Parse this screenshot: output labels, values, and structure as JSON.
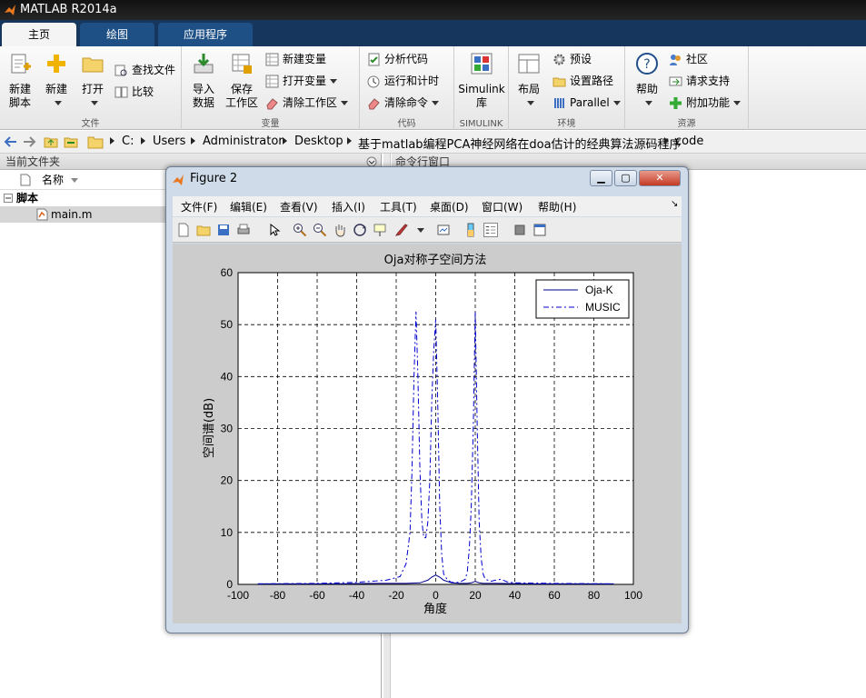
{
  "app": {
    "title": "MATLAB R2014a"
  },
  "tabs": [
    {
      "label": "主页"
    },
    {
      "label": "绘图"
    },
    {
      "label": "应用程序"
    }
  ],
  "ribbon": {
    "new_script": "新建\n脚本",
    "new": "新建",
    "open": "打开",
    "find_files": "查找文件",
    "compare": "比较",
    "file_caption": "文件",
    "import": "导入\n数据",
    "save_ws": "保存\n工作区",
    "new_var": "新建变量",
    "open_var": "打开变量",
    "clear_ws": "清除工作区",
    "var_caption": "变量",
    "analyze": "分析代码",
    "run_time": "运行和计时",
    "clear_cmd": "清除命令",
    "code_caption": "代码",
    "simulink": "Simulink\n库",
    "simulink_caption": "SIMULINK",
    "layout": "布局",
    "prefs": "预设",
    "set_path": "设置路径",
    "parallel": "Parallel",
    "env_caption": "环境",
    "help": "帮助",
    "community": "社区",
    "support": "请求支持",
    "addons": "附加功能",
    "res_caption": "资源"
  },
  "address": {
    "crumbs": [
      "C:",
      "Users",
      "Administrator",
      "Desktop",
      "基于matlab编程PCA神经网络在doa估计的经典算法源码程序",
      "code"
    ]
  },
  "left_panel": {
    "title": "当前文件夹",
    "col_name": "名称",
    "group": "脚本",
    "file": "main.m"
  },
  "command_window": {
    "title": "命令行窗口"
  },
  "figure": {
    "title": "Figure 2",
    "menu": [
      "文件(F)",
      "编辑(E)",
      "查看(V)",
      "插入(I)",
      "工具(T)",
      "桌面(D)",
      "窗口(W)",
      "帮助(H)"
    ]
  },
  "chart_data": {
    "type": "line",
    "title": "Oja对称子空间方法",
    "xlabel": "角度",
    "ylabel": "空间谱(dB)",
    "xlim": [
      -100,
      100
    ],
    "ylim": [
      0,
      60
    ],
    "xticks": [
      -100,
      -80,
      -60,
      -40,
      -20,
      0,
      20,
      40,
      60,
      80,
      100
    ],
    "yticks": [
      0,
      10,
      20,
      30,
      40,
      50,
      60
    ],
    "grid": true,
    "legend_position": "top-right",
    "series": [
      {
        "name": "Oja-K",
        "style": "solid",
        "color": "#00008b",
        "x": [
          -90,
          -70,
          -50,
          -30,
          -15,
          -8,
          -4,
          -2,
          0,
          2,
          4,
          8,
          12,
          16,
          18,
          20,
          22,
          24,
          30,
          50,
          70,
          90
        ],
        "y": [
          0.1,
          0.1,
          0.1,
          0.2,
          0.2,
          0.3,
          0.8,
          1.4,
          1.8,
          1.4,
          0.8,
          0.3,
          0.2,
          0.2,
          0.3,
          0.6,
          0.3,
          0.2,
          0.2,
          0.1,
          0.1,
          0.1
        ]
      },
      {
        "name": "MUSIC",
        "style": "dashdot",
        "color": "#0000cc",
        "x": [
          -90,
          -60,
          -40,
          -25,
          -18,
          -15,
          -13,
          -12,
          -11,
          -10,
          -9,
          -8,
          -7,
          -6,
          -5,
          -4,
          -3,
          -2,
          -1,
          0,
          1,
          2,
          3,
          4,
          6,
          8,
          12,
          15,
          16,
          17,
          18,
          19,
          20,
          21,
          22,
          23,
          24,
          25,
          28,
          30,
          33,
          36,
          40,
          60,
          90
        ],
        "y": [
          0.1,
          0.2,
          0.4,
          0.8,
          1.5,
          4,
          10,
          22,
          40,
          52.5,
          40,
          22,
          12,
          9,
          9,
          12,
          20,
          35,
          45,
          51,
          35,
          15,
          6,
          2,
          0.8,
          0.4,
          0.4,
          1,
          2.5,
          7,
          15,
          30,
          52.5,
          30,
          12,
          5,
          2,
          1,
          0.6,
          0.8,
          1,
          0.5,
          0.3,
          0.2,
          0.1
        ]
      }
    ]
  }
}
